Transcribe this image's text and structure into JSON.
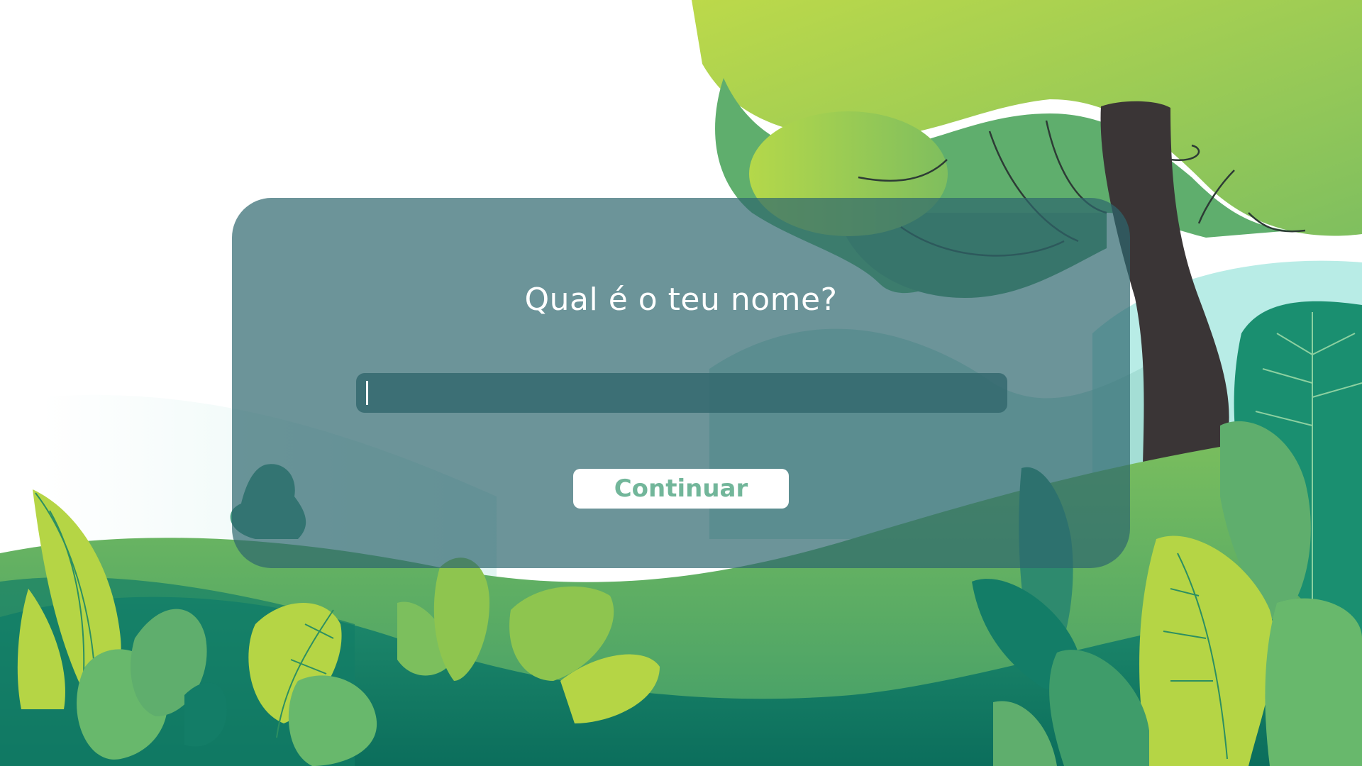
{
  "dialog": {
    "question": "Qual é o teu nome?",
    "name_value": "",
    "continue_label": "Continuar"
  },
  "colors": {
    "panel": "#2e676e",
    "button_text": "#72b69a",
    "tree_trunk": "#3a3536",
    "canopy_light": "#b8d84a",
    "hill_dark": "#0f7a66"
  }
}
